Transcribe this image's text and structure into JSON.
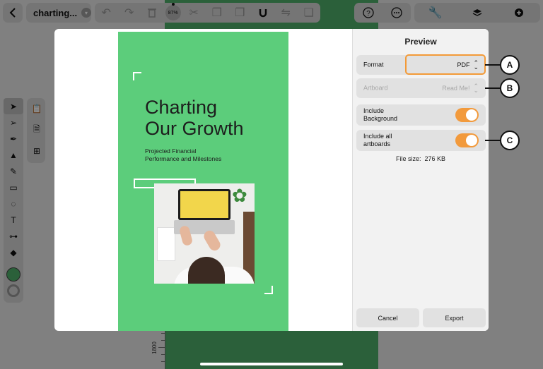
{
  "toolbar": {
    "back_icon": "chevron-left",
    "doc_title": "charting...",
    "zoom": "87%",
    "help_icon": "?",
    "more_icon": "..."
  },
  "ruler": {
    "tick_label": "1800"
  },
  "artboard": {
    "title_line1": "Charting",
    "title_line2": "Our Growth",
    "subtitle_line1": "Projected Financial",
    "subtitle_line2": "Performance and Milestones"
  },
  "preview": {
    "title": "Preview",
    "format_label": "Format",
    "format_value": "PDF",
    "artboard_label": "Artboard",
    "artboard_value": "Read Me!",
    "include_background_line1": "Include",
    "include_background_line2": "Background",
    "include_background_on": true,
    "include_all_line1": "Include all",
    "include_all_line2": "artboards",
    "include_all_on": true,
    "file_size_label": "File size:",
    "file_size_value": "276 KB",
    "cancel_label": "Cancel",
    "export_label": "Export"
  },
  "callouts": {
    "a": "A",
    "b": "B",
    "c": "C"
  },
  "colors": {
    "accent": "#f39a37",
    "canvas_green": "#4fb06a",
    "artboard_green": "#5ccd7b"
  }
}
